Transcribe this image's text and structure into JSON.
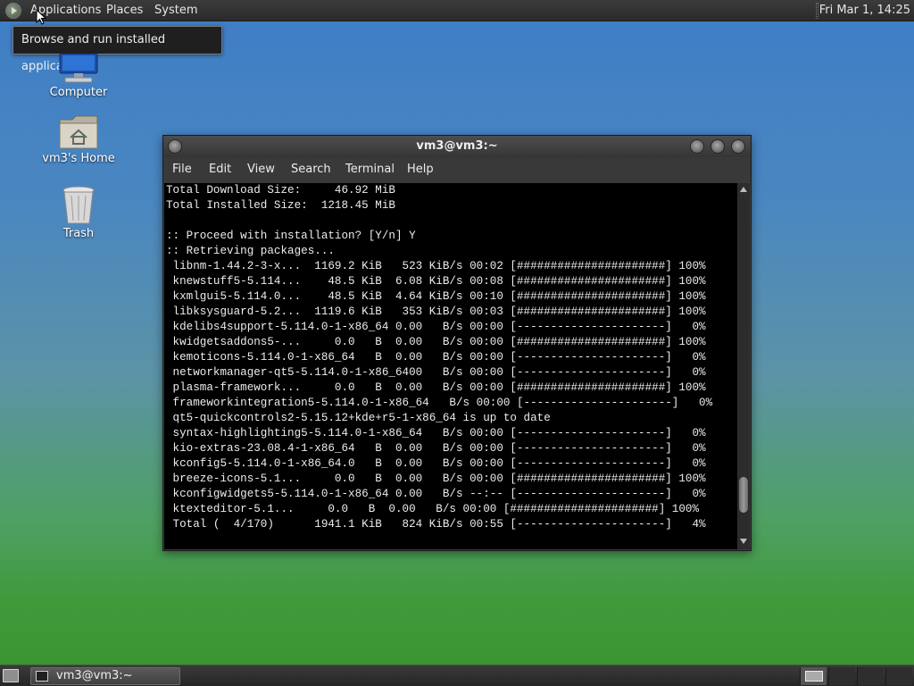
{
  "top_panel": {
    "menus": [
      "Applications",
      "Places",
      "System"
    ],
    "clock": "Fri Mar  1, 14:25"
  },
  "tooltip": "Browse and run installed applications",
  "desktop_icons": [
    {
      "label": "Computer",
      "icon": "computer-icon"
    },
    {
      "label": "vm3's Home",
      "icon": "home-folder-icon"
    },
    {
      "label": "Trash",
      "icon": "trash-icon"
    }
  ],
  "terminal": {
    "title": "vm3@vm3:~",
    "menu": [
      "File",
      "Edit",
      "View",
      "Search",
      "Terminal",
      "Help"
    ],
    "scroll_position": 0.92,
    "lines": [
      "Total Download Size:     46.92 MiB",
      "Total Installed Size:  1218.45 MiB",
      "",
      ":: Proceed with installation? [Y/n] Y",
      ":: Retrieving packages...",
      " libnm-1.44.2-3-x...  1169.2 KiB   523 KiB/s 00:02 [######################] 100%",
      " knewstuff5-5.114...    48.5 KiB  6.08 KiB/s 00:08 [######################] 100%",
      " kxmlgui5-5.114.0...    48.5 KiB  4.64 KiB/s 00:10 [######################] 100%",
      " libksysguard-5.2...  1119.6 KiB   353 KiB/s 00:03 [######################] 100%",
      " kdelibs4support-5.114.0-1-x86_64 0.00   B/s 00:00 [----------------------]   0%",
      " kwidgetsaddons5-...     0.0   B  0.00   B/s 00:00 [######################] 100%",
      " kemoticons-5.114.0-1-x86_64   B  0.00   B/s 00:00 [----------------------]   0%",
      " networkmanager-qt5-5.114.0-1-x86_6400   B/s 00:00 [----------------------]   0%",
      " plasma-framework...     0.0   B  0.00   B/s 00:00 [######################] 100%",
      " frameworkintegration5-5.114.0-1-x86_64   B/s 00:00 [----------------------]   0%",
      " qt5-quickcontrols2-5.15.12+kde+r5-1-x86_64 is up to date",
      " syntax-highlighting5-5.114.0-1-x86_64   B/s 00:00 [----------------------]   0%",
      " kio-extras-23.08.4-1-x86_64   B  0.00   B/s 00:00 [----------------------]   0%",
      " kconfig5-5.114.0-1-x86_64.0   B  0.00   B/s 00:00 [----------------------]   0%",
      " breeze-icons-5.1...     0.0   B  0.00   B/s 00:00 [######################] 100%",
      " kconfigwidgets5-5.114.0-1-x86_64 0.00   B/s --:-- [----------------------]   0%",
      " ktexteditor-5.1...     0.0   B  0.00   B/s 00:00 [######################] 100%",
      " Total (  4/170)      1941.1 KiB   824 KiB/s 00:55 [----------------------]   4%"
    ]
  },
  "taskbar": {
    "task_label": "vm3@vm3:~",
    "task_icon": "terminal-icon",
    "workspaces": 4
  }
}
